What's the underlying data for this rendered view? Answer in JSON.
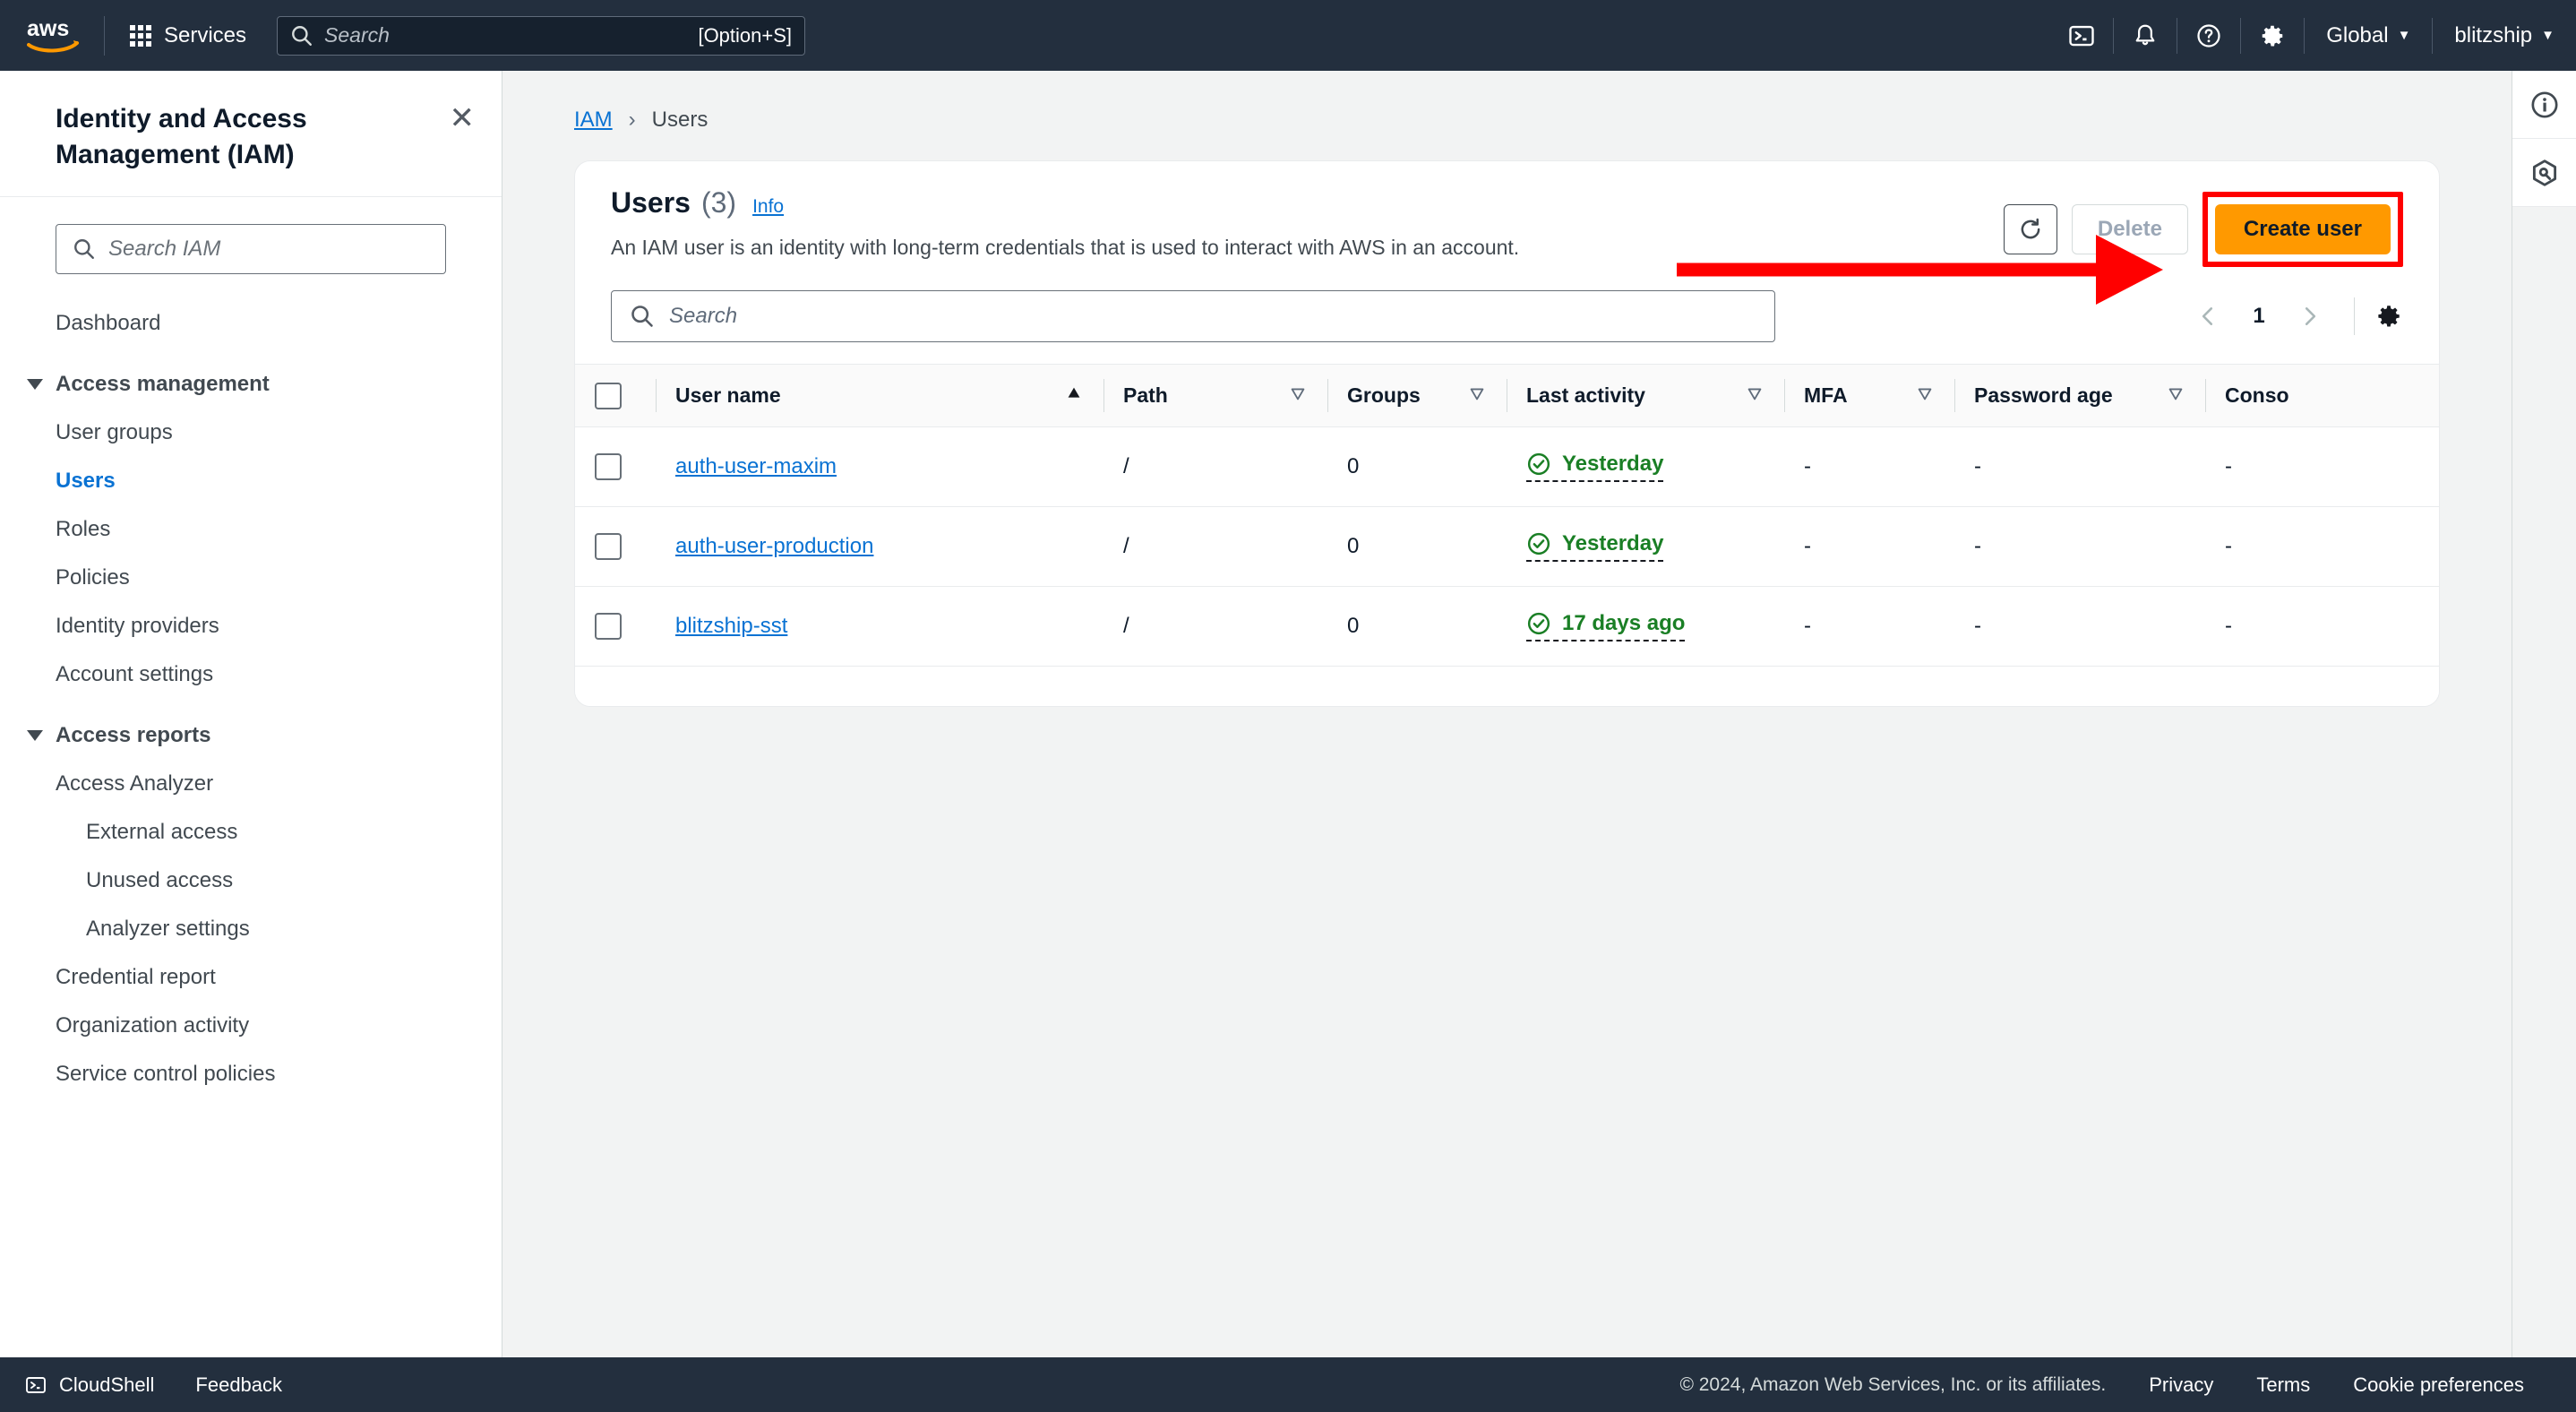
{
  "topnav": {
    "logo_alt": "aws",
    "services_label": "Services",
    "search_placeholder": "Search",
    "search_value": "",
    "search_shortcut": "[Option+S]",
    "icons": [
      "cloudshell-icon",
      "bell-icon",
      "help-icon",
      "settings-gear-icon"
    ],
    "region_label": "Global",
    "account_label": "blitzship"
  },
  "sidebar": {
    "title": "Identity and Access Management (IAM)",
    "close_label": "✕",
    "search_placeholder": "Search IAM",
    "search_value": "",
    "items": [
      {
        "label": "Dashboard",
        "type": "item",
        "active": false
      },
      {
        "label": "Access management",
        "type": "group"
      },
      {
        "label": "User groups",
        "type": "item",
        "active": false
      },
      {
        "label": "Users",
        "type": "item",
        "active": true
      },
      {
        "label": "Roles",
        "type": "item",
        "active": false
      },
      {
        "label": "Policies",
        "type": "item",
        "active": false
      },
      {
        "label": "Identity providers",
        "type": "item",
        "active": false
      },
      {
        "label": "Account settings",
        "type": "item",
        "active": false
      },
      {
        "label": "Access reports",
        "type": "group"
      },
      {
        "label": "Access Analyzer",
        "type": "item",
        "active": false
      },
      {
        "label": "External access",
        "type": "sub",
        "active": false
      },
      {
        "label": "Unused access",
        "type": "sub",
        "active": false
      },
      {
        "label": "Analyzer settings",
        "type": "sub",
        "active": false
      },
      {
        "label": "Credential report",
        "type": "item",
        "active": false
      },
      {
        "label": "Organization activity",
        "type": "item",
        "active": false
      },
      {
        "label": "Service control policies",
        "type": "item",
        "active": false
      }
    ]
  },
  "breadcrumb": {
    "root": "IAM",
    "separator": "›",
    "current": "Users"
  },
  "panel": {
    "title": "Users",
    "count": "(3)",
    "info_label": "Info",
    "description": "An IAM user is an identity with long-term credentials that is used to interact with AWS in an account.",
    "refresh_label": "refresh-icon",
    "delete_label": "Delete",
    "create_label": "Create user",
    "highlight_color": "#ff0000",
    "primary_color": "#ff9900"
  },
  "filter": {
    "search_placeholder": "Search",
    "search_value": "",
    "prev_label": "‹",
    "page_number": "1",
    "next_label": "›",
    "settings_label": "preferences-gear-icon"
  },
  "table": {
    "columns": [
      {
        "key": "name",
        "label": "User name",
        "sort": "asc"
      },
      {
        "key": "path",
        "label": "Path",
        "sort": "none"
      },
      {
        "key": "groups",
        "label": "Groups",
        "sort": "none"
      },
      {
        "key": "last",
        "label": "Last activity",
        "sort": "none"
      },
      {
        "key": "mfa",
        "label": "MFA",
        "sort": "none"
      },
      {
        "key": "pwd",
        "label": "Password age",
        "sort": "none"
      },
      {
        "key": "console",
        "label": "Conso",
        "sort": "none"
      }
    ],
    "rows": [
      {
        "name": "auth-user-maxim",
        "path": "/",
        "groups": "0",
        "last_activity": "Yesterday",
        "mfa": "-",
        "password_age": "-",
        "console": "-"
      },
      {
        "name": "auth-user-production",
        "path": "/",
        "groups": "0",
        "last_activity": "Yesterday",
        "mfa": "-",
        "password_age": "-",
        "console": "-"
      },
      {
        "name": "blitzship-sst",
        "path": "/",
        "groups": "0",
        "last_activity": "17 days ago",
        "mfa": "-",
        "password_age": "-",
        "console": "-"
      }
    ],
    "activity_color": "#1a7f25"
  },
  "rail": {
    "items": [
      "info-circle-icon",
      "amazon-q-icon"
    ]
  },
  "footer": {
    "cloudshell": "CloudShell",
    "feedback": "Feedback",
    "copyright": "© 2024, Amazon Web Services, Inc. or its affiliates.",
    "privacy": "Privacy",
    "terms": "Terms",
    "cookie": "Cookie preferences"
  }
}
